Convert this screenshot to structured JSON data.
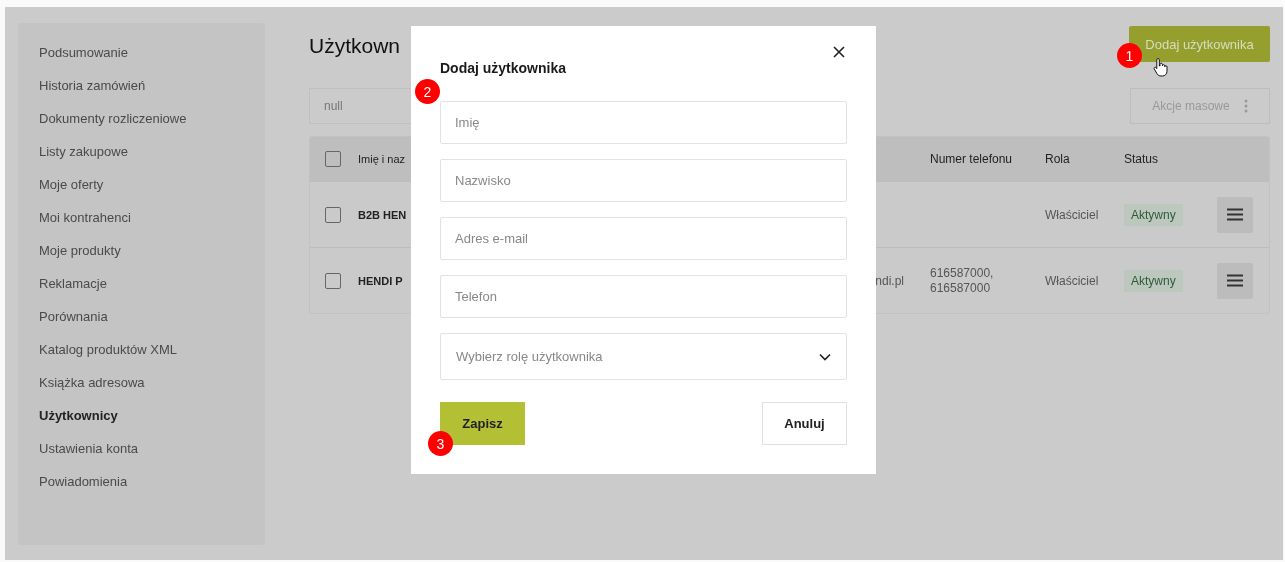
{
  "sidebar": {
    "items": [
      {
        "label": "Podsumowanie",
        "selected": false
      },
      {
        "label": "Historia zamówień",
        "selected": false
      },
      {
        "label": "Dokumenty rozliczeniowe",
        "selected": false
      },
      {
        "label": "Listy zakupowe",
        "selected": false
      },
      {
        "label": "Moje oferty",
        "selected": false
      },
      {
        "label": "Moi kontrahenci",
        "selected": false
      },
      {
        "label": "Moje produkty",
        "selected": false
      },
      {
        "label": "Reklamacje",
        "selected": false
      },
      {
        "label": "Porównania",
        "selected": false
      },
      {
        "label": "Katalog produktów XML",
        "selected": false
      },
      {
        "label": "Książka adresowa",
        "selected": false
      },
      {
        "label": "Użytkownicy",
        "selected": true
      },
      {
        "label": "Ustawienia konta",
        "selected": false
      },
      {
        "label": "Powiadomienia",
        "selected": false
      }
    ]
  },
  "page": {
    "title": "Użytkown",
    "add_button": "Dodaj użytkownika",
    "search": {
      "value": "null"
    },
    "bulk_button": "Akcje masowe"
  },
  "table": {
    "columns": [
      "Imię i naz",
      "Numer telefonu",
      "Rola",
      "Status"
    ],
    "header_checked": false,
    "rows": [
      {
        "checked": false,
        "name": "B2B HEN",
        "role": "Właściciel",
        "status": "Aktywny"
      },
      {
        "checked": false,
        "name": "HENDI P",
        "email": "ndi.pl",
        "phone": "616587000, 616587000",
        "role": "Właściciel",
        "status": "Aktywny"
      }
    ]
  },
  "modal": {
    "title": "Dodaj użytkownika",
    "fields": [
      {
        "placeholder": "Imię"
      },
      {
        "placeholder": "Nazwisko"
      },
      {
        "placeholder": "Adres e-mail"
      },
      {
        "placeholder": "Telefon"
      }
    ],
    "select": {
      "placeholder": "Wybierz rolę użytkownika"
    },
    "save_button": "Zapisz",
    "cancel_button": "Anuluj"
  },
  "step_markers": [
    "1",
    "2",
    "3"
  ]
}
